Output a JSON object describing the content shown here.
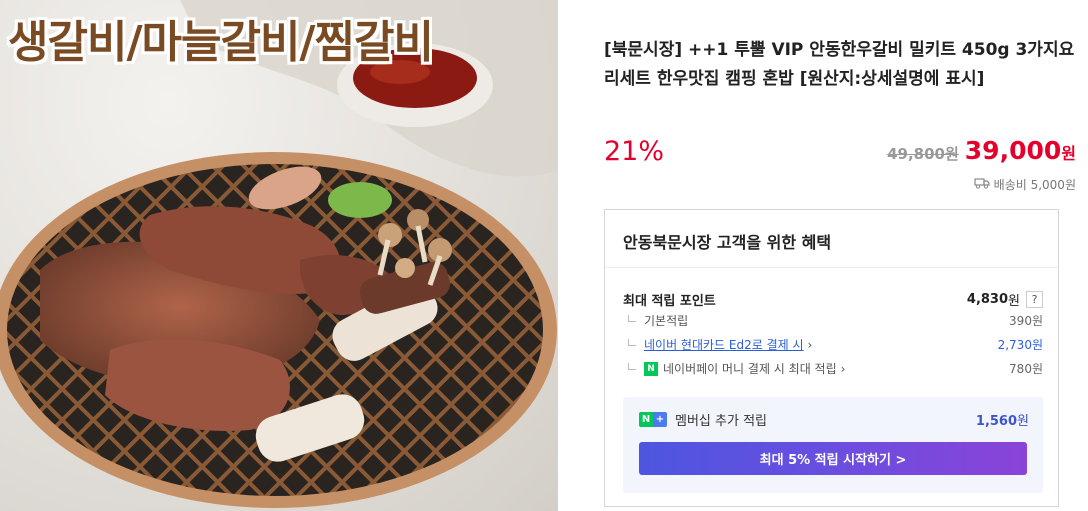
{
  "image": {
    "caption": "생갈비/마늘갈비/찜갈비"
  },
  "product": {
    "title": "[북문시장] ++1 투뿔 VIP 안동한우갈비 밀키트 450g 3가지요리세트 한우맛집 캠핑 혼밥 [원산지:상세설명에 표시]",
    "discount_rate": "21%",
    "original_price": "49,800원",
    "sale_price": "39,000",
    "sale_unit": "원",
    "shipping": "배송비 5,000원"
  },
  "benefits": {
    "title": "안동북문시장 고객을 위한 혜택",
    "max_point_label": "최대 적립 포인트",
    "max_point_value": "4,830",
    "max_point_unit": "원",
    "help": "?",
    "items": [
      {
        "label": "기본적립",
        "value": "390원"
      },
      {
        "label": "네이버 현대카드 Ed2로 결제 시",
        "value": "2,730원"
      },
      {
        "label": "네이버페이 머니 결제 시 최대 적립",
        "value": "780원"
      }
    ],
    "membership": {
      "label": "멤버십 추가 적립",
      "value": "1,560",
      "unit": "원",
      "button": "최대 5% 적립 시작하기 >"
    }
  },
  "icons": {
    "truck": "truck-icon",
    "help": "help-icon",
    "chevron": "chevron-right-icon",
    "npay": "naver-pay-icon",
    "membership": "naver-plus-membership-icon"
  },
  "colors": {
    "accent_red": "#e4002b",
    "link_blue": "#2b5fd9",
    "naver_green": "#03c75a",
    "cta_start": "#4d56e0",
    "cta_end": "#8b43d8"
  }
}
